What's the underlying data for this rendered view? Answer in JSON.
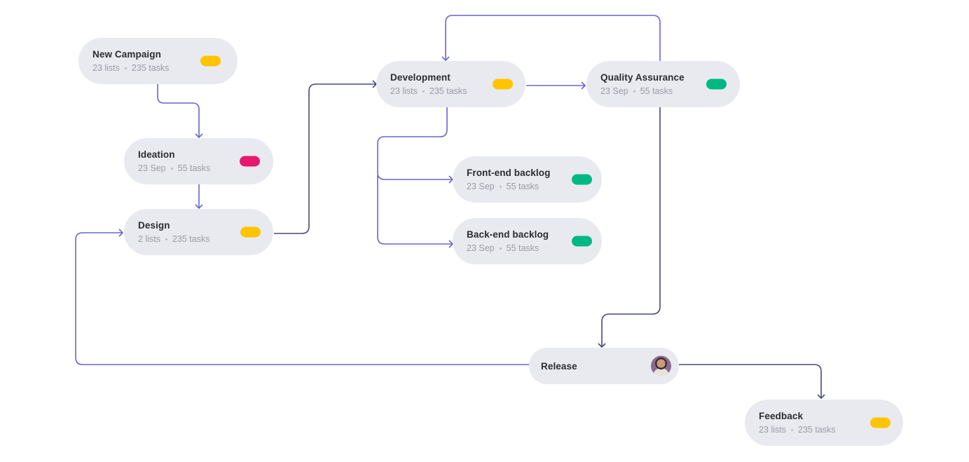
{
  "colors": {
    "background": "#ffffff",
    "node_fill": "#e9eaf0",
    "link_light": "#6b63d4",
    "link_dark": "#4a4878",
    "status_yellow": "#ffc400",
    "status_pink": "#e8186f",
    "status_green": "#00b884"
  },
  "nodes": [
    {
      "id": "new-campaign",
      "title": "New Campaign",
      "meta_left": "23 lists",
      "meta_right": "235 tasks",
      "status": "yellow"
    },
    {
      "id": "ideation",
      "title": "Ideation",
      "meta_left": "23 Sep",
      "meta_right": "55 tasks",
      "status": "pink"
    },
    {
      "id": "design",
      "title": "Design",
      "meta_left": "2 lists",
      "meta_right": "235 tasks",
      "status": "yellow"
    },
    {
      "id": "development",
      "title": "Development",
      "meta_left": "23 lists",
      "meta_right": "235 tasks",
      "status": "yellow"
    },
    {
      "id": "quality-assurance",
      "title": "Quality Assurance",
      "meta_left": "23 Sep",
      "meta_right": "55 tasks",
      "status": "green"
    },
    {
      "id": "front-end-backlog",
      "title": "Front-end backlog",
      "meta_left": "23 Sep",
      "meta_right": "55 tasks",
      "status": "green"
    },
    {
      "id": "back-end-backlog",
      "title": "Back-end backlog",
      "meta_left": "23 Sep",
      "meta_right": "55 tasks",
      "status": "green"
    },
    {
      "id": "release",
      "title": "Release",
      "avatar": "user-avatar"
    },
    {
      "id": "feedback",
      "title": "Feedback",
      "meta_left": "23 lists",
      "meta_right": "235 tasks",
      "status": "yellow"
    }
  ],
  "links": [
    {
      "from": "new-campaign",
      "to": "ideation",
      "tone": "light"
    },
    {
      "from": "ideation",
      "to": "design",
      "tone": "light"
    },
    {
      "from": "design",
      "to": "development",
      "tone": "dark"
    },
    {
      "from": "development",
      "to": "quality-assurance",
      "tone": "light"
    },
    {
      "from": "development",
      "to": "front-end-backlog",
      "tone": "light"
    },
    {
      "from": "development",
      "to": "back-end-backlog",
      "tone": "light"
    },
    {
      "from": "quality-assurance",
      "to": "development",
      "tone": "light"
    },
    {
      "from": "quality-assurance",
      "to": "release",
      "tone": "dark"
    },
    {
      "from": "release",
      "to": "design",
      "tone": "light"
    },
    {
      "from": "release",
      "to": "feedback",
      "tone": "dark"
    }
  ]
}
